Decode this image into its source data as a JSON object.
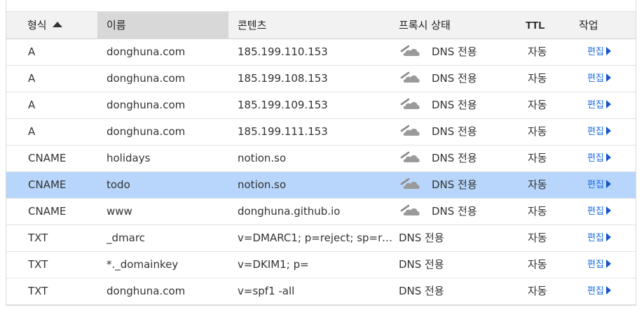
{
  "columns": {
    "type": "형식",
    "name": "이름",
    "content": "콘텐츠",
    "proxy": "프록시 상태",
    "ttl": "TTL",
    "action": "작업"
  },
  "sort": {
    "column": "형식",
    "direction": "ascending"
  },
  "rows": [
    {
      "type": "A",
      "name": "donghuna.com",
      "content": "185.199.110.153",
      "proxy": "DNS 전용",
      "cloud_icon": true,
      "ttl": "자동",
      "action": "편집",
      "selected": false
    },
    {
      "type": "A",
      "name": "donghuna.com",
      "content": "185.199.108.153",
      "proxy": "DNS 전용",
      "cloud_icon": true,
      "ttl": "자동",
      "action": "편집",
      "selected": false
    },
    {
      "type": "A",
      "name": "donghuna.com",
      "content": "185.199.109.153",
      "proxy": "DNS 전용",
      "cloud_icon": true,
      "ttl": "자동",
      "action": "편집",
      "selected": false
    },
    {
      "type": "A",
      "name": "donghuna.com",
      "content": "185.199.111.153",
      "proxy": "DNS 전용",
      "cloud_icon": true,
      "ttl": "자동",
      "action": "편집",
      "selected": false
    },
    {
      "type": "CNAME",
      "name": "holidays",
      "content": "notion.so",
      "proxy": "DNS 전용",
      "cloud_icon": true,
      "ttl": "자동",
      "action": "편집",
      "selected": false
    },
    {
      "type": "CNAME",
      "name": "todo",
      "content": "notion.so",
      "proxy": "DNS 전용",
      "cloud_icon": true,
      "ttl": "자동",
      "action": "편집",
      "selected": true
    },
    {
      "type": "CNAME",
      "name": "www",
      "content": "donghuna.github.io",
      "proxy": "DNS 전용",
      "cloud_icon": true,
      "ttl": "자동",
      "action": "편집",
      "selected": false
    },
    {
      "type": "TXT",
      "name": "_dmarc",
      "content": "v=DMARC1; p=reject; sp=rej...",
      "proxy": "DNS 전용",
      "cloud_icon": false,
      "ttl": "자동",
      "action": "편집",
      "selected": false
    },
    {
      "type": "TXT",
      "name": "*._domainkey",
      "content": "v=DKIM1; p=",
      "proxy": "DNS 전용",
      "cloud_icon": false,
      "ttl": "자동",
      "action": "편집",
      "selected": false
    },
    {
      "type": "TXT",
      "name": "donghuna.com",
      "content": "v=spf1 -all",
      "proxy": "DNS 전용",
      "cloud_icon": false,
      "ttl": "자동",
      "action": "편집",
      "selected": false
    }
  ],
  "colors": {
    "selected_row": "#b8d6fb",
    "header_bg": "#f2f2f2",
    "sorted_header_bg": "#d8d8d8",
    "link": "#1a6ae3",
    "cloud_grey": "#8a8a8a"
  }
}
